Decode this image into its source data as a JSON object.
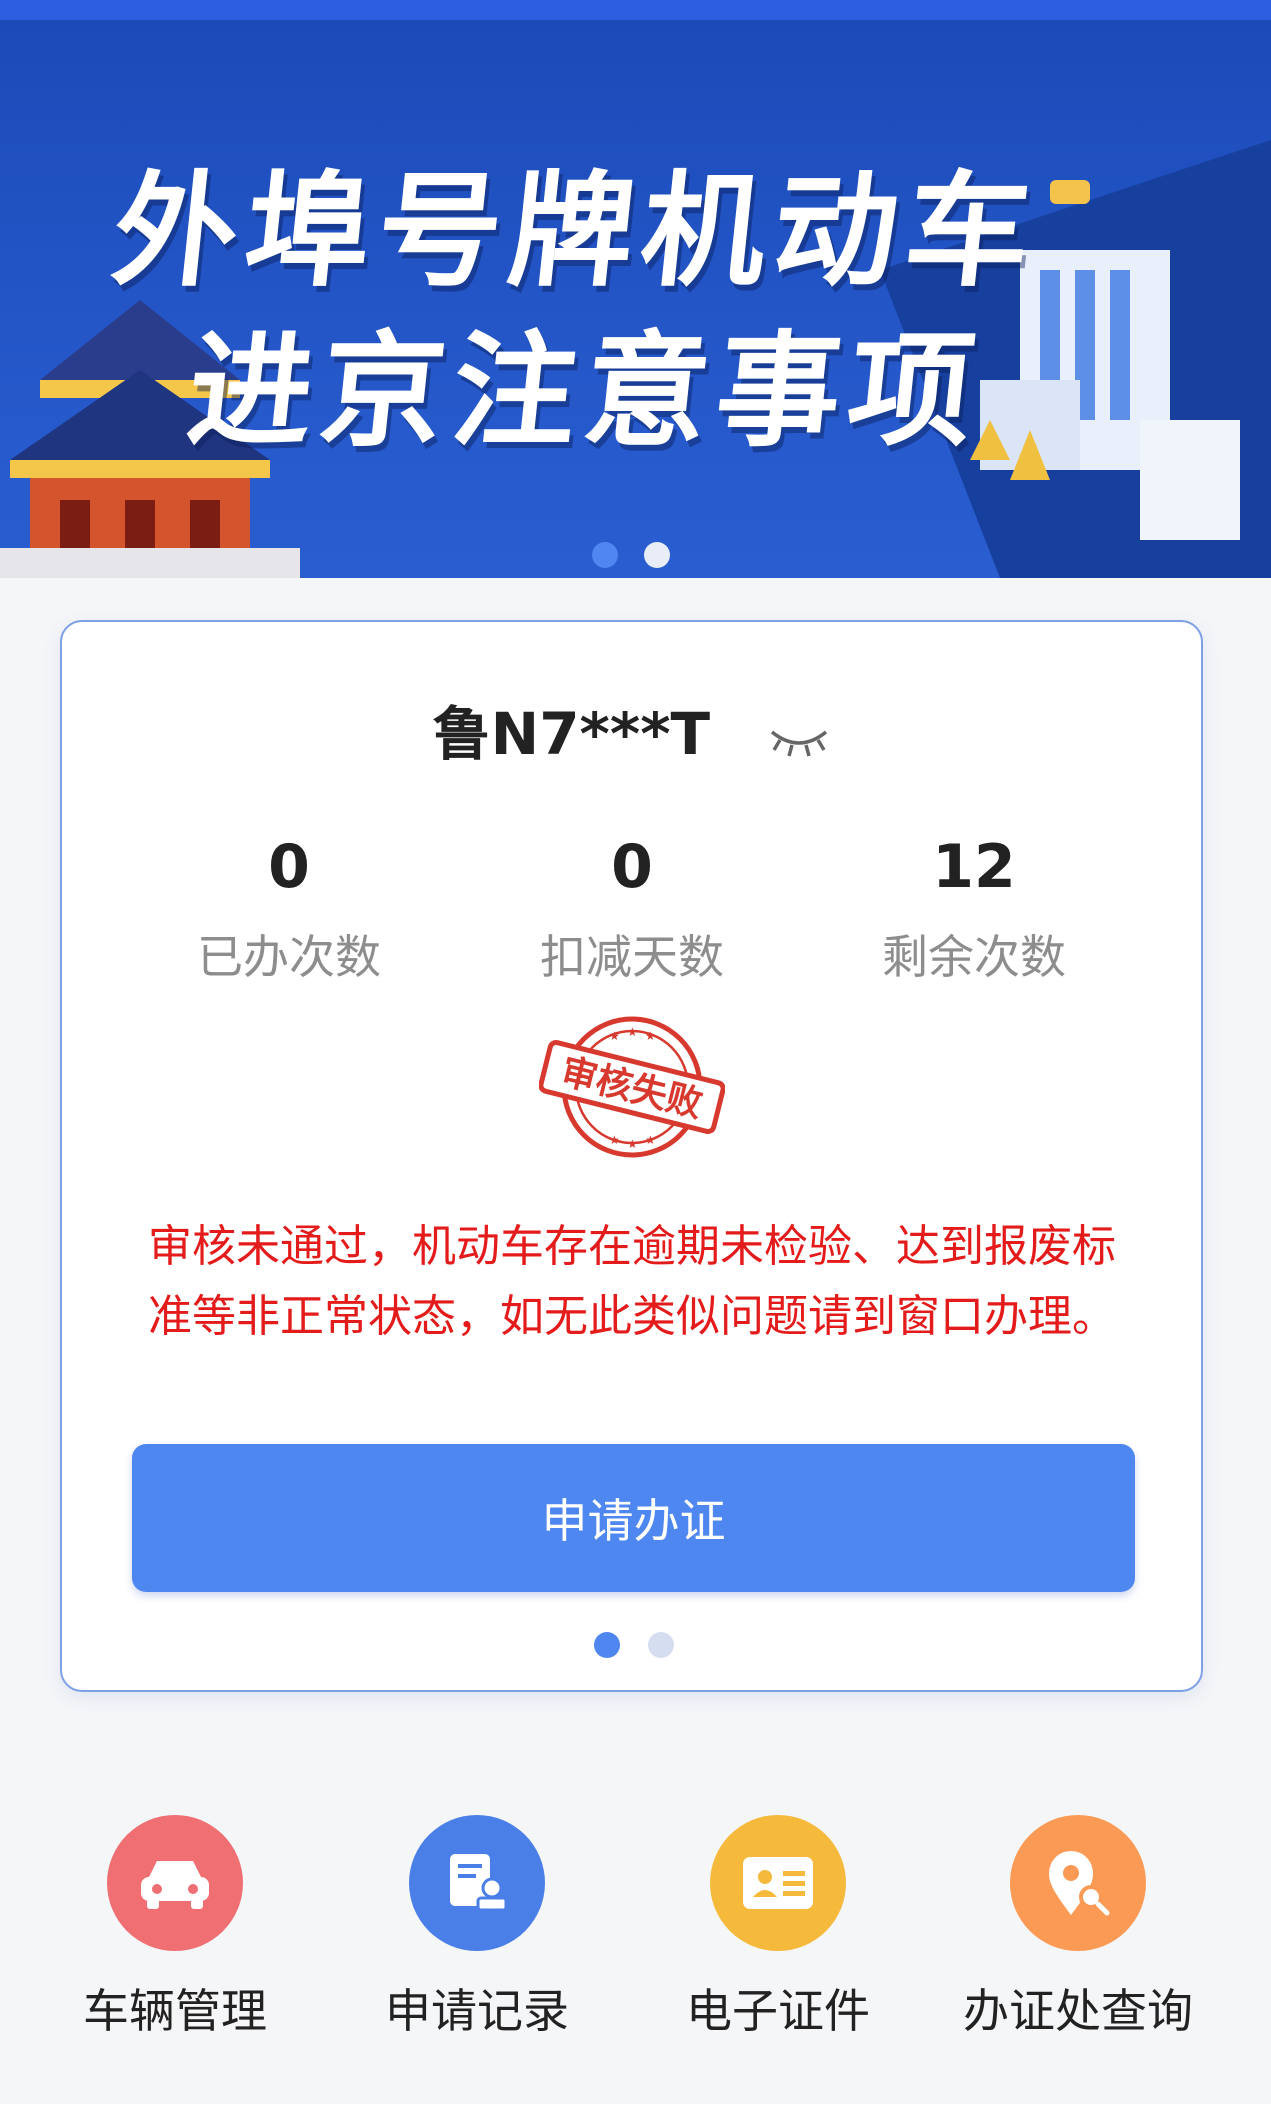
{
  "banner": {
    "title_line1": "外埠号牌机动车",
    "title_line2": "进京注意事项",
    "dots": 2,
    "active_dot": 0
  },
  "card": {
    "plate": "鲁N7***T",
    "stats": [
      {
        "value": "0",
        "label": "已办次数"
      },
      {
        "value": "0",
        "label": "扣减天数"
      },
      {
        "value": "12",
        "label": "剩余次数"
      }
    ],
    "stamp_text": "审核失败",
    "message": "审核未通过，机动车存在逾期未检验、达到报废标准等非正常状态，如无此类似问题请到窗口办理。",
    "apply_button": "申请办证",
    "dots": 2,
    "active_dot": 0
  },
  "nav": [
    {
      "label": "车辆管理",
      "icon": "car-icon",
      "color": "#ef6f73"
    },
    {
      "label": "申请记录",
      "icon": "record-icon",
      "color": "#4a7fe8"
    },
    {
      "label": "电子证件",
      "icon": "id-card-icon",
      "color": "#f5b93c"
    },
    {
      "label": "办证处查询",
      "icon": "location-search-icon",
      "color": "#fa9a55"
    }
  ],
  "colors": {
    "primary": "#4f87f1",
    "error": "#e41b1b",
    "banner_bg": "#2456c8"
  }
}
